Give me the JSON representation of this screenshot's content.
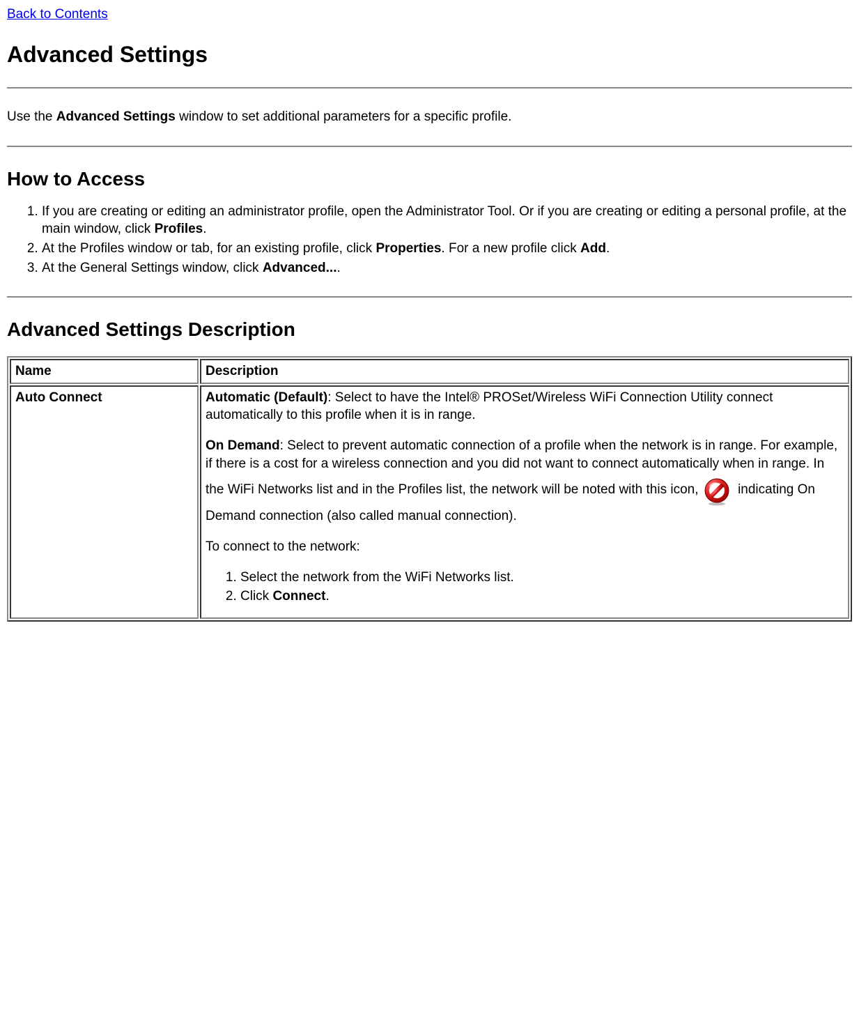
{
  "backLink": "Back to Contents",
  "title": "Advanced Settings",
  "intro": {
    "prefix": "Use the ",
    "bold": "Advanced Settings",
    "suffix": " window to set additional parameters for a specific profile."
  },
  "howToAccess": {
    "heading": "How to Access",
    "steps": [
      {
        "prefix": "If you are creating or editing an administrator profile, open the Administrator Tool. Or if you are creating or editing a personal profile, at the main window, click ",
        "bold": "Profiles",
        "suffix": "."
      },
      {
        "prefix": "At the Profiles window or tab, for an existing profile, click ",
        "bold": "Properties",
        "mid": ". For a new profile click ",
        "bold2": "Add",
        "suffix": "."
      },
      {
        "prefix": "At the General Settings window, click ",
        "bold": "Advanced...",
        "suffix": "."
      }
    ]
  },
  "descSection": {
    "heading": "Advanced Settings Description",
    "headers": {
      "name": "Name",
      "description": "Description"
    },
    "rows": [
      {
        "name": "Auto Connect",
        "auto": {
          "bold": "Automatic (Default)",
          "text": ": Select to have the Intel® PROSet/Wireless WiFi Connection Utility connect automatically to this profile when it is in range."
        },
        "onDemand": {
          "bold": "On Demand",
          "textBefore": ": Select to prevent automatic connection of a profile when the network is in range. For example, if there is a cost for a wireless connection and you did not want to connect automatically when in range. In the WiFi Networks list and in the Profiles list, the network will be noted with this icon, ",
          "textAfter": " indicating On Demand connection (also called manual connection)."
        },
        "connectIntro": "To connect to the network:",
        "connectSteps": [
          "Select the network from the WiFi Networks list.",
          {
            "prefix": "Click ",
            "bold": "Connect",
            "suffix": "."
          }
        ]
      }
    ]
  }
}
